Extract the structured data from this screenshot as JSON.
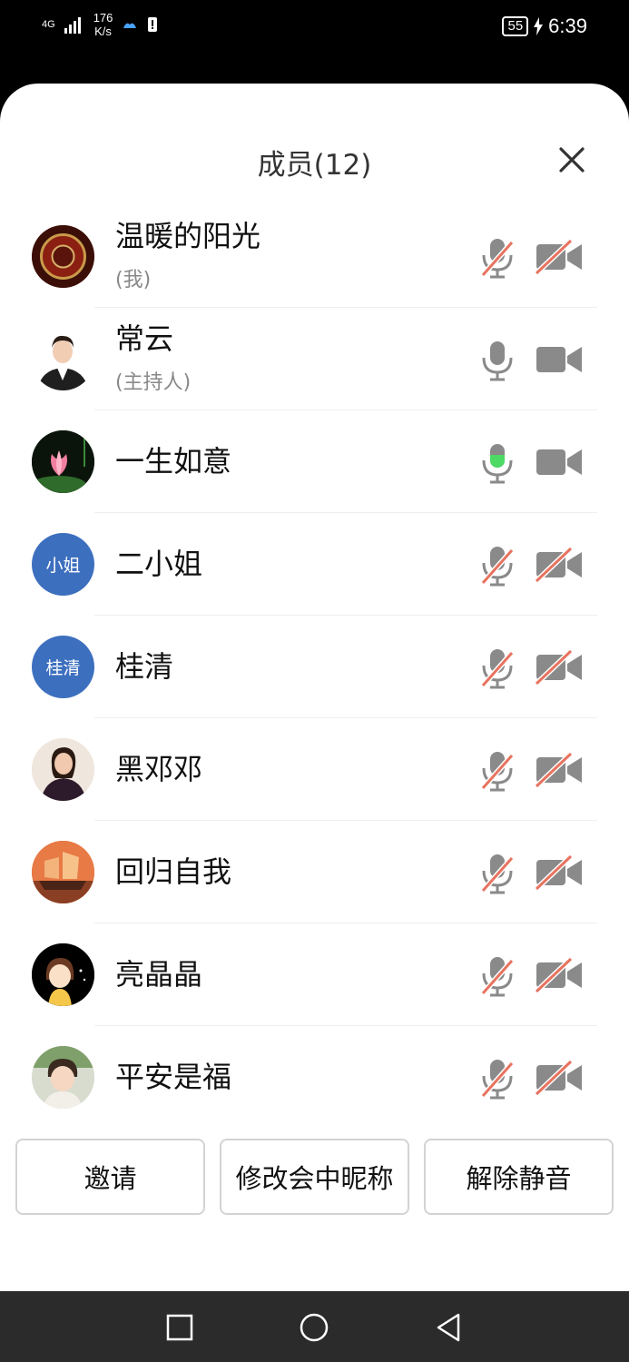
{
  "status_bar": {
    "network": "4G",
    "speed_value": "176",
    "speed_unit": "K/s",
    "battery": "55",
    "time": "6:39"
  },
  "panel": {
    "title": "成员(12)"
  },
  "members": [
    {
      "name": "温暖的阳光",
      "role": "(我)",
      "mic": "muted",
      "camera": "off"
    },
    {
      "name": "常云",
      "role": "(主持人)",
      "mic": "on",
      "camera": "on"
    },
    {
      "name": "一生如意",
      "role": "",
      "mic": "speaking",
      "camera": "on"
    },
    {
      "name": "二小姐",
      "role": "",
      "avatar_text": "小姐",
      "mic": "muted",
      "camera": "off"
    },
    {
      "name": "桂清",
      "role": "",
      "avatar_text": "桂清",
      "mic": "muted",
      "camera": "off"
    },
    {
      "name": "黑邓邓",
      "role": "",
      "mic": "muted",
      "camera": "off"
    },
    {
      "name": "回归自我",
      "role": "",
      "mic": "muted",
      "camera": "off"
    },
    {
      "name": "亮晶晶",
      "role": "",
      "mic": "muted",
      "camera": "off"
    },
    {
      "name": "平安是福",
      "role": "",
      "mic": "muted",
      "camera": "off"
    }
  ],
  "actions": {
    "invite": "邀请",
    "rename": "修改会中昵称",
    "unmute": "解除静音"
  },
  "colors": {
    "avatar_blue": "#3d6fbf",
    "speaking_green": "#4cd964",
    "muted_slash": "#e8735f",
    "icon_gray": "#8a8a8a"
  }
}
